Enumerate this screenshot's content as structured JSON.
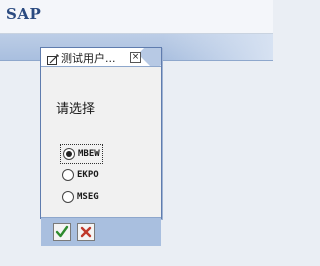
{
  "app": {
    "title": "SAP"
  },
  "popup": {
    "title": "测试用户...",
    "prompt": "请选择",
    "options": [
      {
        "label": "MBEW",
        "selected": true
      },
      {
        "label": "EKPO",
        "selected": false
      },
      {
        "label": "MSEG",
        "selected": false
      }
    ],
    "buttons": {
      "confirm": "check-icon",
      "cancel": "cross-icon"
    }
  },
  "colors": {
    "band": "#a9bfdf",
    "confirm_green": "#2e8b2e",
    "cancel_red": "#c0392b",
    "title_blue": "#2a4a80"
  }
}
